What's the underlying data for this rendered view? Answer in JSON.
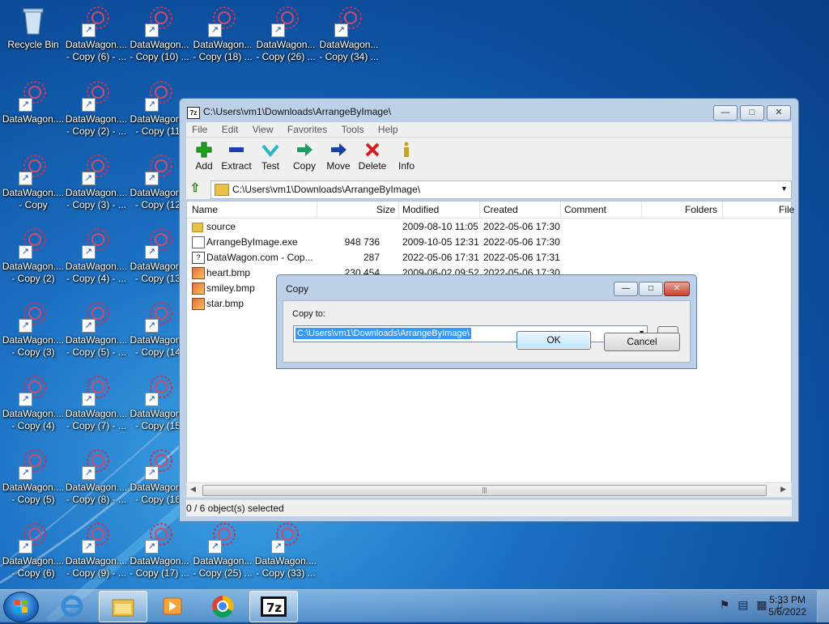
{
  "desktop": {
    "icons": [
      {
        "label": "Recycle Bin",
        "label2": ""
      },
      {
        "label": "DataWagon....",
        "label2": "- Copy (6) - ..."
      },
      {
        "label": "DataWagon...",
        "label2": "- Copy (10) ..."
      },
      {
        "label": "DataWagon...",
        "label2": "- Copy (18) ..."
      },
      {
        "label": "DataWagon...",
        "label2": "- Copy (26) ..."
      },
      {
        "label": "DataWagon...",
        "label2": "- Copy (34) ..."
      },
      {
        "label": "DataWagon....",
        "label2": ""
      },
      {
        "label": "DataWagon....",
        "label2": "- Copy (2) - ..."
      },
      {
        "label": "DataWagon...",
        "label2": "- Copy (11)"
      },
      {
        "label": "DataWagon....",
        "label2": "- Copy"
      },
      {
        "label": "DataWagon....",
        "label2": "- Copy (3) - ..."
      },
      {
        "label": "DataWagon...",
        "label2": "- Copy (12)"
      },
      {
        "label": "DataWagon....",
        "label2": "- Copy (2)"
      },
      {
        "label": "DataWagon....",
        "label2": "- Copy (4) - ..."
      },
      {
        "label": "DataWagon...",
        "label2": "- Copy (13)"
      },
      {
        "label": "DataWagon....",
        "label2": "- Copy (3)"
      },
      {
        "label": "DataWagon....",
        "label2": "- Copy (5) - ..."
      },
      {
        "label": "DataWagon...",
        "label2": "- Copy (14)"
      },
      {
        "label": "DataWagon....",
        "label2": "- Copy (4)"
      },
      {
        "label": "DataWagon....",
        "label2": "- Copy (7) - ..."
      },
      {
        "label": "DataWagon...",
        "label2": "- Copy (15)"
      },
      {
        "label": "DataWagon....",
        "label2": "- Copy (5)"
      },
      {
        "label": "DataWagon....",
        "label2": "- Copy (8) - ..."
      },
      {
        "label": "DataWagon...",
        "label2": "- Copy (16)"
      },
      {
        "label": "DataWagon....",
        "label2": "- Copy (6)"
      },
      {
        "label": "DataWagon....",
        "label2": "- Copy (9) - ..."
      },
      {
        "label": "DataWagon...",
        "label2": "- Copy (17) ..."
      },
      {
        "label": "DataWagon...",
        "label2": "- Copy (25) ..."
      },
      {
        "label": "DataWagon....",
        "label2": "- Copy (33) ..."
      }
    ]
  },
  "window": {
    "title": "C:\\Users\\vm1\\Downloads\\ArrangeByImage\\",
    "title_icon": "7z",
    "menu": [
      "File",
      "Edit",
      "View",
      "Favorites",
      "Tools",
      "Help"
    ],
    "toolbar": [
      {
        "label": "Add",
        "icon": "add-icon",
        "color": "#1fa11f"
      },
      {
        "label": "Extract",
        "icon": "extract-icon",
        "color": "#1d3fb3"
      },
      {
        "label": "Test",
        "icon": "test-icon",
        "color": "#2bb5c9"
      },
      {
        "label": "Copy",
        "icon": "copy-icon",
        "color": "#1f9b6b"
      },
      {
        "label": "Move",
        "icon": "move-icon",
        "color": "#1a3fa8"
      },
      {
        "label": "Delete",
        "icon": "delete-icon",
        "color": "#d81b1b"
      },
      {
        "label": "Info",
        "icon": "info-icon",
        "color": "#c8a41a"
      }
    ],
    "address": "C:\\Users\\vm1\\Downloads\\ArrangeByImage\\",
    "columns": [
      "Name",
      "Size",
      "Modified",
      "Created",
      "Comment",
      "Folders",
      "File"
    ],
    "rows": [
      {
        "name": "source",
        "type": "folder",
        "size": "",
        "modified": "2009-08-10 11:05",
        "created": "2022-05-06 17:30"
      },
      {
        "name": "ArrangeByImage.exe",
        "type": "exe",
        "size": "948 736",
        "modified": "2009-10-05 12:31",
        "created": "2022-05-06 17:30"
      },
      {
        "name": "DataWagon.com - Cop...",
        "type": "txt",
        "size": "287",
        "modified": "2022-05-06 17:31",
        "created": "2022-05-06 17:31"
      },
      {
        "name": "heart.bmp",
        "type": "bmp",
        "size": "230 454",
        "modified": "2009-06-02 09:52",
        "created": "2022-05-06 17:30"
      },
      {
        "name": "smiley.bmp",
        "type": "bmp",
        "size": "",
        "modified": "",
        "created": ""
      },
      {
        "name": "star.bmp",
        "type": "bmp",
        "size": "",
        "modified": "",
        "created": ""
      }
    ],
    "status": "0 / 6 object(s) selected"
  },
  "dialog": {
    "title": "Copy",
    "copy_to_label": "Copy to:",
    "path": "C:\\Users\\vm1\\Downloads\\ArrangeByImage\\",
    "ok": "OK",
    "cancel": "Cancel",
    "browse": "..."
  },
  "taskbar": {
    "time": "5:33 PM",
    "date": "5/6/2022",
    "apps": [
      "explorer",
      "internet-explorer",
      "file-manager",
      "media-player",
      "chrome",
      "7zip"
    ]
  }
}
